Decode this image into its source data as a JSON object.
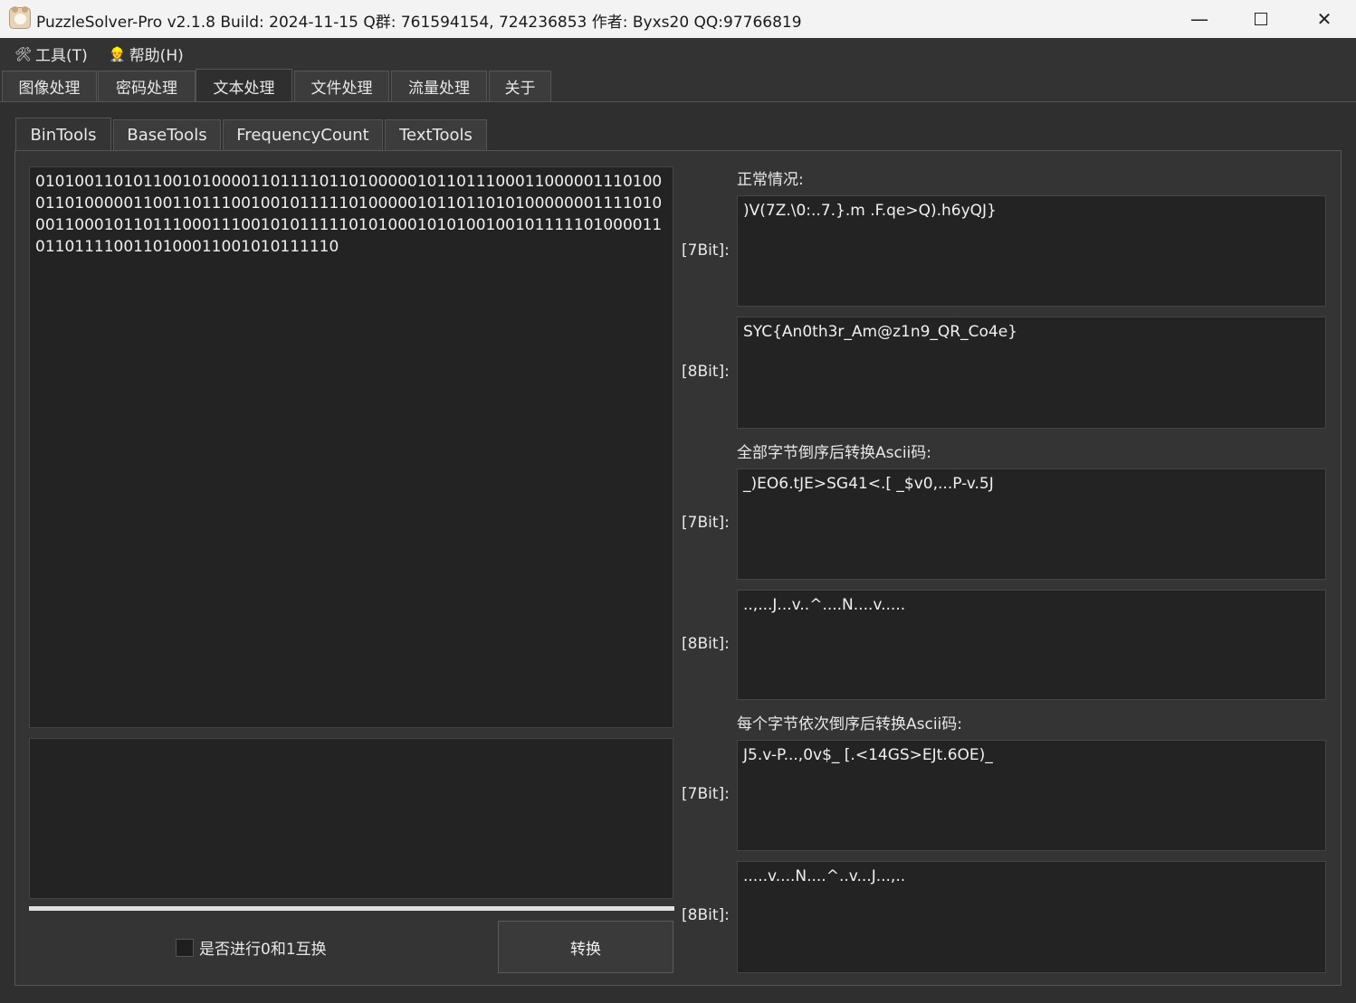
{
  "window": {
    "title": "PuzzleSolver-Pro v2.1.8  Build: 2024-11-15  Q群: 761594154, 724236853  作者: Byxs20  QQ:97766819",
    "min_glyph": "—",
    "close_glyph": "✕"
  },
  "menu": [
    {
      "label": "工具(T)",
      "icon": "tools-icon"
    },
    {
      "label": "帮助(H)",
      "icon": "help-person-icon"
    }
  ],
  "main_tabs": [
    "图像处理",
    "密码处理",
    "文本处理",
    "文件处理",
    "流量处理",
    "关于"
  ],
  "main_tab_active": "文本处理",
  "sub_tabs": [
    "BinTools",
    "BaseTools",
    "FrequencyCount",
    "TextTools"
  ],
  "sub_tab_active": "BinTools",
  "input": {
    "text": "0101001101011001010000110111101101000001011011100011000001110100011010000011001101110010010111110100000101101101010000000111101000110001011011100011100101011111010100010101001001011111010000110110111100110100011001010111110"
  },
  "output_box": {
    "text": ""
  },
  "sections": {
    "normal_label": "正常情况:",
    "reverse_all_label": "全部字节倒序后转换Ascii码:",
    "reverse_each_label": "每个字节依次倒序后转换Ascii码:",
    "bit7_label": "[7Bit]:",
    "bit8_label": "[8Bit]:"
  },
  "results": {
    "normal_7bit": ")V(7Z.\\0:..7.}.m .F.qe>Q).h6yQJ}",
    "normal_8bit": "SYC{An0th3r_Am@z1n9_QR_Co4e}",
    "reverse_all_7bit": "_)EO6.tJE>SG41<.[ _$v0,...P-v.5J",
    "reverse_all_8bit": "..,...J...v..^....N....v.....",
    "reverse_each_7bit": "J5.v-P...,0v$_ [.<14GS>EJt.6OE)_",
    "reverse_each_8bit": ".....v....N....^..v...J...,.."
  },
  "controls": {
    "swap_checkbox_label": "是否进行0和1互换",
    "swap_checked": false,
    "convert_button": "转换"
  }
}
